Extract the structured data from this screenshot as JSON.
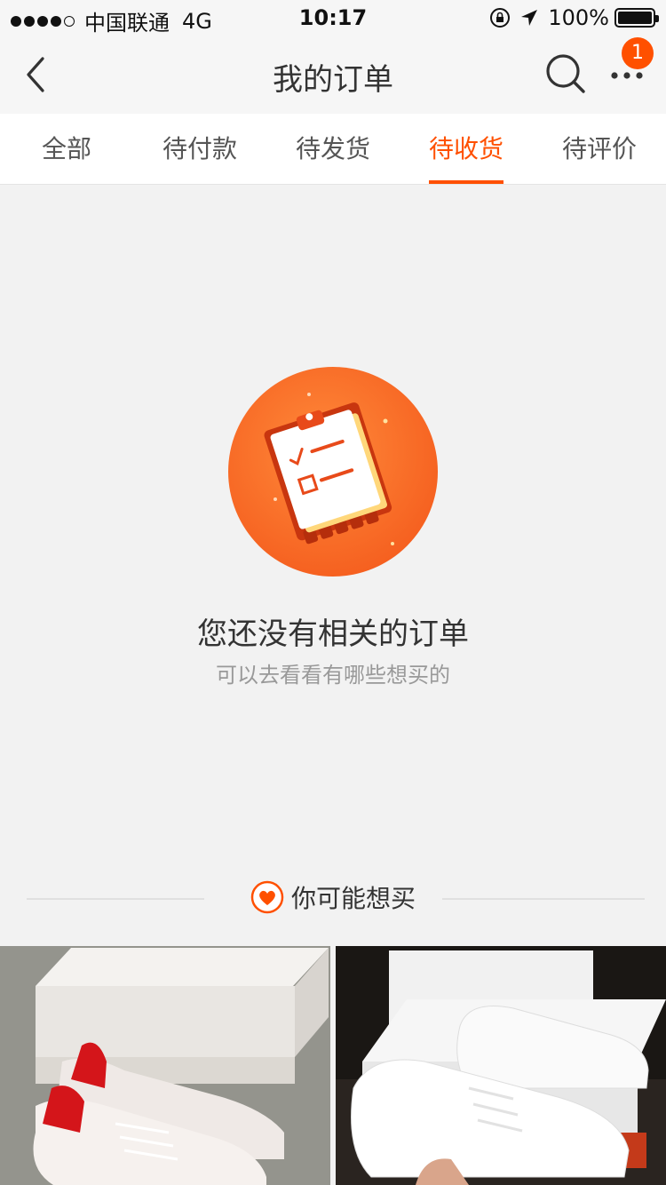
{
  "status_bar": {
    "carrier": "中国联通",
    "network": "4G",
    "time": "10:17",
    "battery": "100%"
  },
  "nav": {
    "title": "我的订单",
    "badge_count": "1",
    "icons": [
      "back-arrow-icon",
      "search-icon",
      "more-icon"
    ]
  },
  "tabs": [
    {
      "label": "全部",
      "active": false
    },
    {
      "label": "待付款",
      "active": false
    },
    {
      "label": "待发货",
      "active": false
    },
    {
      "label": "待收货",
      "active": true
    },
    {
      "label": "待评价",
      "active": false
    }
  ],
  "empty_state": {
    "title": "您还没有相关的订单",
    "subtitle": "可以去看看有哪些想买的",
    "illustration": "clipboard-illustration"
  },
  "recommend": {
    "title": "你可能想买",
    "icon": "heart-icon"
  },
  "colors": {
    "accent": "#ff5000",
    "background": "#f2f2f2"
  }
}
